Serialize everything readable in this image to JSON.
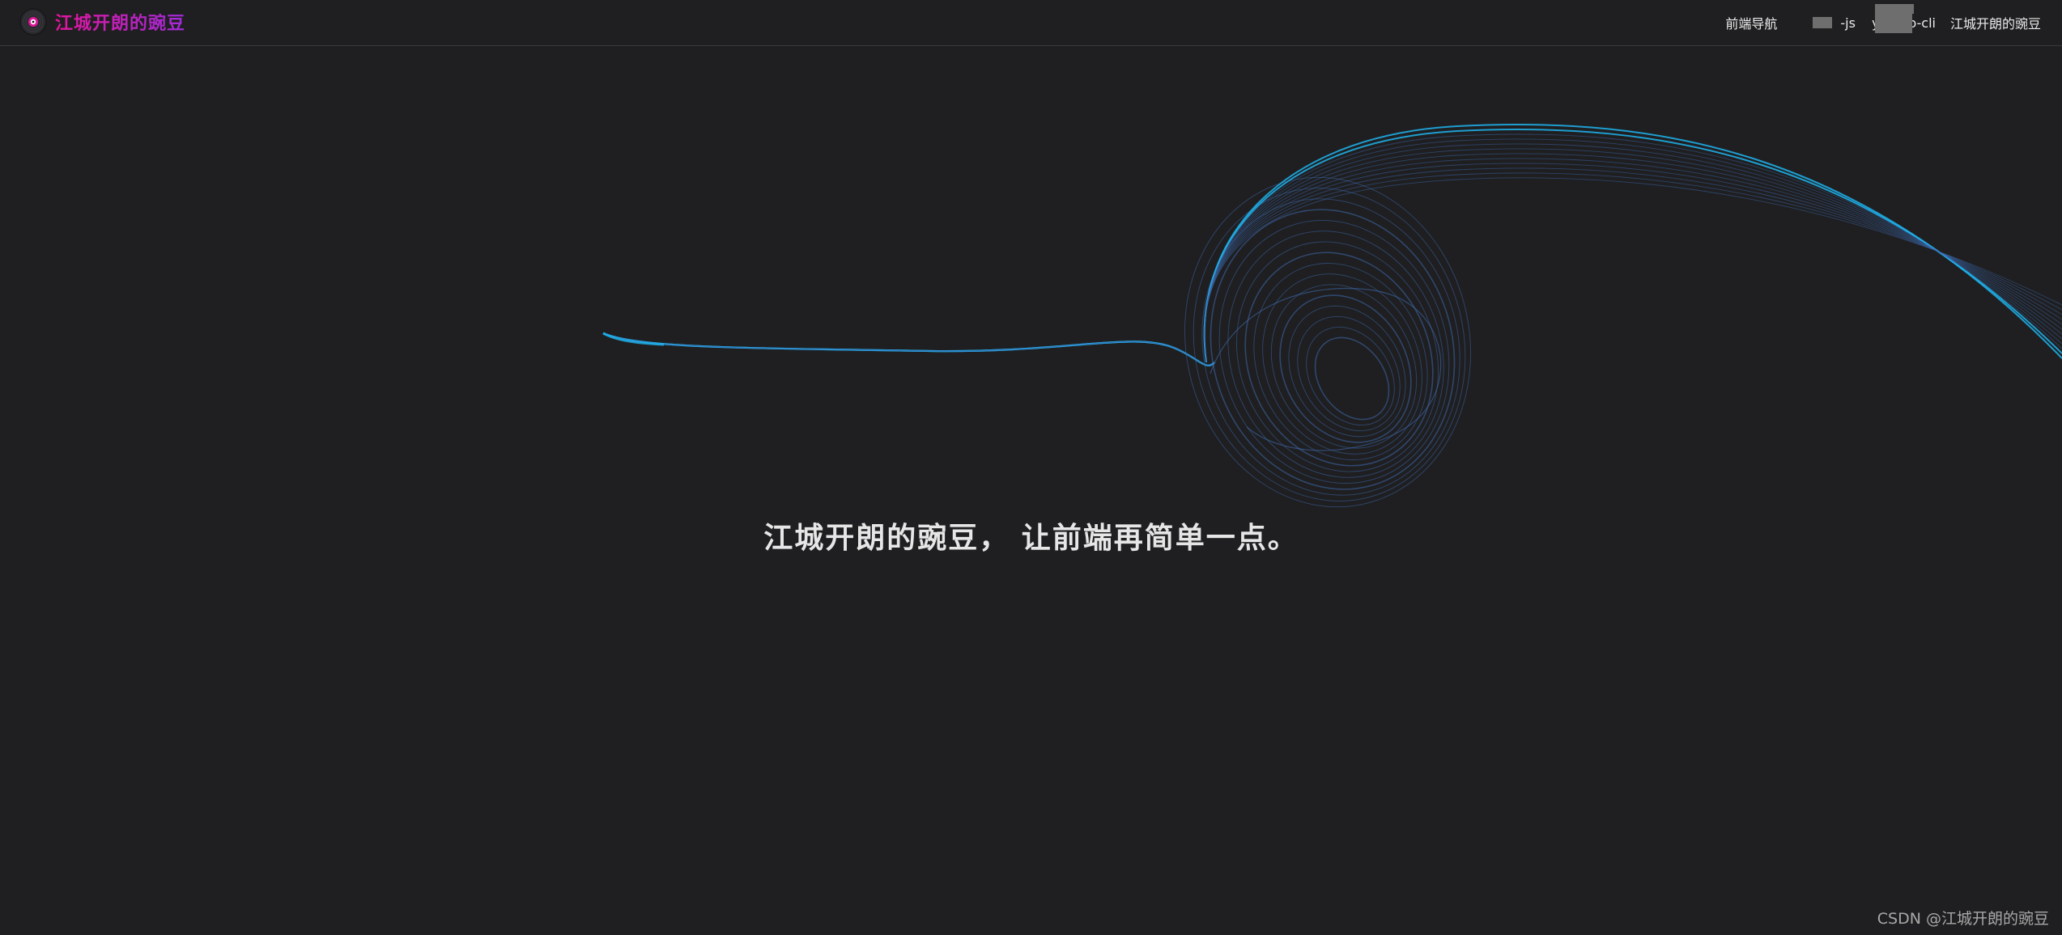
{
  "header": {
    "site_title": "江城开朗的豌豆",
    "logo_icon": "vinyl-record-icon",
    "nav": [
      {
        "label": "前端导航"
      },
      {
        "label": "-js"
      },
      {
        "label": "y"
      },
      {
        "label": "o-cli"
      },
      {
        "label": "江城开朗的豌豆"
      }
    ]
  },
  "hero": {
    "tagline": "江城开朗的豌豆， 让前端再简单一点。"
  },
  "footer": {
    "credit": "CSDN @江城开朗的豌豆"
  },
  "colors": {
    "background": "#1f1f21",
    "title_gradient_start": "#e0169c",
    "title_gradient_end": "#a12bd8",
    "curve_bright": "#1fb5f0",
    "curve_dim": "#3f6fb8"
  }
}
